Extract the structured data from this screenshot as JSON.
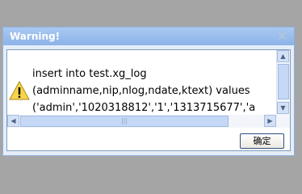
{
  "dialog": {
    "title": "Warning!",
    "close_icon": "close-icon",
    "icon": "warning-icon",
    "message_lines": [
      "insert into test.xg_log",
      "(adminname,nip,nlog,ndate,ktext) values",
      "('admin','1020318812','1','1313715677','a"
    ],
    "ok_label": "确定"
  },
  "scrollbar": {
    "up_arrow": "▲",
    "down_arrow": "▼",
    "left_arrow": "◀",
    "right_arrow": "▶",
    "thumb_grip": "|||"
  }
}
